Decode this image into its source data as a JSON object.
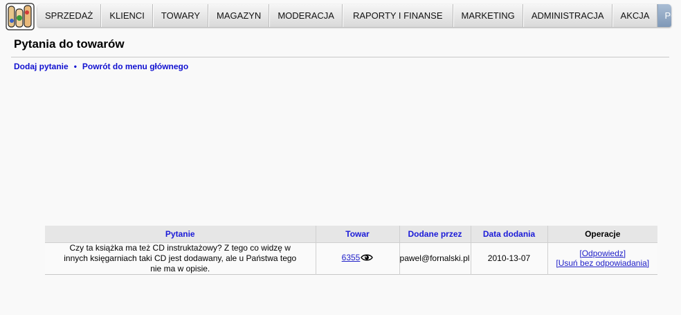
{
  "nav": {
    "items": [
      "SPRZEDAŻ",
      "KLIENCI",
      "TOWARY",
      "MAGAZYN",
      "MODERACJA",
      "RAPORTY I FINANSE",
      "MARKETING",
      "ADMINISTRACJA",
      "AKCJA"
    ],
    "help_label": "POMOC",
    "help_icon": "?"
  },
  "page": {
    "title": "Pytania do towarów",
    "links": {
      "add_question": "Dodaj pytanie",
      "separator": "•",
      "back_to_menu": "Powrót do menu głównego"
    }
  },
  "table": {
    "headers": {
      "question": "Pytanie",
      "product": "Towar",
      "added_by": "Dodane przez",
      "date": "Data dodania",
      "operations": "Operacje"
    },
    "rows": [
      {
        "question": "Czy ta książka ma też CD instruktażowy? Z tego co widzę w innych księgarniach taki CD jest dodawany, ale u Państwa tego nie ma w opisie.",
        "product_id": "6355",
        "added_by": "pawel@fornalski.pl",
        "date": "2010-13-07",
        "answer_label": "[Odpowiedz]",
        "delete_label": "[Usuń bez odpowiadania]"
      }
    ]
  },
  "colors": {
    "link": "#1010d0",
    "help_bg": "#8fa6c2",
    "help_icon": "#6aad1e"
  }
}
